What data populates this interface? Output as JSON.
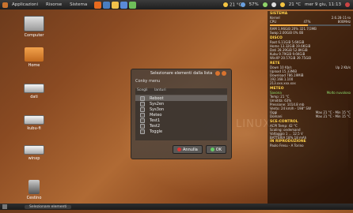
{
  "top_panel": {
    "menus": [
      "Applicazioni",
      "Risorse",
      "Sistema"
    ],
    "launcher_icons": [
      "firefox-icon",
      "people-icon",
      "music-icon",
      "email-icon",
      "chat-icon"
    ],
    "weather_left": "21 °C",
    "tray_percent": "57%",
    "weather_right": "21 °C",
    "clock": "mer 9 giu, 11:13"
  },
  "desktop": {
    "icons": [
      {
        "label": "Computer",
        "icon": "computer-icon"
      },
      {
        "label": "Home",
        "icon": "home-folder-icon"
      },
      {
        "label": "dati",
        "icon": "drive-icon"
      },
      {
        "label": "kubu-fi",
        "icon": "drive-icon"
      },
      {
        "label": "winxp",
        "icon": "drive-icon"
      },
      {
        "label": "Cestino",
        "icon": "trash-icon"
      }
    ],
    "wallpaper_text": "LINUX"
  },
  "dialog": {
    "title": "Selezionare elementi dalla lista",
    "menu_label": "Conky menu",
    "columns": [
      "Scegli",
      "lanturi"
    ],
    "items": [
      {
        "label": "Reboot",
        "selected": true
      },
      {
        "label": "Sys2en",
        "selected": false
      },
      {
        "label": "Sys3on",
        "selected": false
      },
      {
        "label": "Meteo",
        "selected": false
      },
      {
        "label": "Test1",
        "selected": false
      },
      {
        "label": "Test2",
        "selected": false
      },
      {
        "label": "Toggle",
        "selected": false
      }
    ],
    "cancel_label": "Annulla",
    "ok_label": "OK"
  },
  "conky": {
    "system": {
      "title": "SISTEMA",
      "kernel": "2.6.28-11-lo",
      "cpu": "47%",
      "cpu_freq": "800MHz",
      "ram": "RAM 1.96GiB 20% 321.7/3MB",
      "swap": "Swap 2.00GiB 0% 0B"
    },
    "disk": {
      "title": "DISCO",
      "rows": [
        "Root 6.11GiB 5.6KGiB",
        "Home 13.32GiB 19.6KGiB",
        "Dati 28.39GiB 52.8KGiB",
        "Kubu 9.79GiB 9.6KGiB",
        "WinXP 20.57GiB 39.75GiB"
      ]
    },
    "net": {
      "title": "RETE",
      "status": "Down 10 Kb/s",
      "up": "Up 2 Kb/s",
      "upload": "Upload 15.33MiB",
      "download": "Download 786.19MiB",
      "ip": "192.168.1.100",
      "ip_ext": "213.xxx.xxx.xxx"
    },
    "meteo": {
      "title": "METEO",
      "city": "Savona",
      "condition": "Molto nuvoloso",
      "temp": "Temp: 21 °C",
      "umidity": "Umidità: 63%",
      "pressure": "Pressione: 1014.8 mb",
      "vento": "Vento: 24 km/h - 198° SW",
      "day1": "Oggi",
      "day1_temp": "Max 21 °C - Min 15 °C",
      "day2": "Domani",
      "day2_temp": "Max 21 °C - Min 15 °C"
    },
    "footer": {
      "title": "SCE-CONTROL",
      "line1": "ACPI Temp: 42 °C",
      "line2": "Scaling: ondemand",
      "line3": "Voltaggio 1 ... 12.5 V",
      "line4": "BATTERIA 18% 18 mAh",
      "rip_title": "IN RIPRODUZIONE",
      "rip_track": "Paolo Fresu - A Torino"
    }
  },
  "bottom_panel": {
    "task_label": "Selezionare elementi"
  },
  "colors": {
    "accent": "#d9732e",
    "conky_header": "#ffd24d",
    "conky_green": "#8fdf6f"
  }
}
